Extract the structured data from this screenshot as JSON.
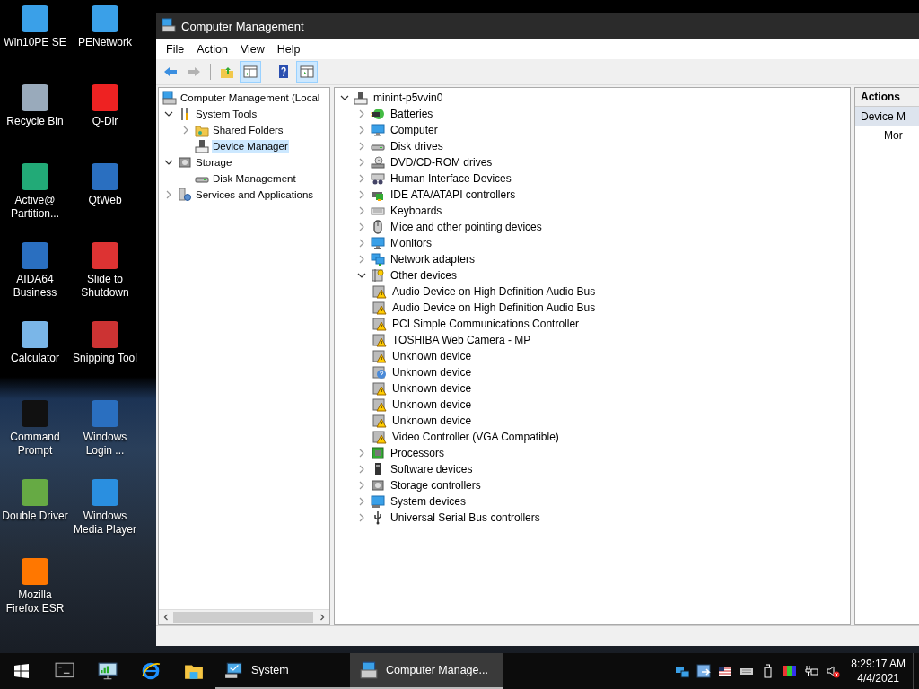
{
  "desktop_icons": [
    {
      "label": "Win10PE SE"
    },
    {
      "label": "PENetwork"
    },
    {
      "label": "Recycle Bin"
    },
    {
      "label": "Q-Dir"
    },
    {
      "label": "Active@ Partition..."
    },
    {
      "label": "QtWeb"
    },
    {
      "label": "AIDA64 Business"
    },
    {
      "label": "Slide to Shutdown"
    },
    {
      "label": "Calculator"
    },
    {
      "label": "Snipping Tool"
    },
    {
      "label": "Command Prompt"
    },
    {
      "label": "Windows Login ..."
    },
    {
      "label": "Double Driver"
    },
    {
      "label": "Windows Media Player"
    },
    {
      "label": "Mozilla Firefox ESR"
    }
  ],
  "window": {
    "title": "Computer Management"
  },
  "menu": [
    "File",
    "Action",
    "View",
    "Help"
  ],
  "toolbar": [
    {
      "pressed": false,
      "disabled": false
    },
    {
      "pressed": false,
      "disabled": true
    },
    {
      "pressed": false,
      "disabled": false
    },
    {
      "pressed": true,
      "disabled": false
    },
    {
      "pressed": false,
      "disabled": false
    },
    {
      "pressed": true,
      "disabled": false
    }
  ],
  "console_tree": {
    "label": "Computer Management (Local",
    "selected": false,
    "children": [
      {
        "label": "System Tools",
        "expanded": true,
        "selected": false,
        "children": [
          {
            "label": "Shared Folders",
            "expanded": false,
            "selected": false
          },
          {
            "label": "Device Manager",
            "selected": true
          }
        ]
      },
      {
        "label": "Storage",
        "expanded": true,
        "selected": false,
        "children": [
          {
            "label": "Disk Management",
            "selected": false
          }
        ]
      },
      {
        "label": "Services and Applications",
        "expanded": false,
        "selected": false
      }
    ]
  },
  "device_tree": {
    "label": "minint-p5vvin0",
    "expanded": true,
    "children": [
      {
        "label": "Batteries",
        "expanded": false
      },
      {
        "label": "Computer",
        "expanded": false
      },
      {
        "label": "Disk drives",
        "expanded": false
      },
      {
        "label": "DVD/CD-ROM drives",
        "expanded": false
      },
      {
        "label": "Human Interface Devices",
        "expanded": false
      },
      {
        "label": "IDE ATA/ATAPI controllers",
        "expanded": false
      },
      {
        "label": "Keyboards",
        "expanded": false
      },
      {
        "label": "Mice and other pointing devices",
        "expanded": false
      },
      {
        "label": "Monitors",
        "expanded": false
      },
      {
        "label": "Network adapters",
        "expanded": false
      },
      {
        "label": "Other devices",
        "expanded": true,
        "children": [
          {
            "label": "Audio Device on High Definition Audio Bus",
            "kind": "warning"
          },
          {
            "label": "Audio Device on High Definition Audio Bus",
            "kind": "warning"
          },
          {
            "label": "PCI Simple Communications Controller",
            "kind": "warning"
          },
          {
            "label": "TOSHIBA Web Camera - MP",
            "kind": "warning"
          },
          {
            "label": "Unknown device",
            "kind": "warning"
          },
          {
            "label": "Unknown device",
            "kind": "unknown"
          },
          {
            "label": "Unknown device",
            "kind": "warning"
          },
          {
            "label": "Unknown device",
            "kind": "warning"
          },
          {
            "label": "Unknown device",
            "kind": "warning"
          },
          {
            "label": "Video Controller (VGA Compatible)",
            "kind": "warning"
          }
        ]
      },
      {
        "label": "Processors",
        "expanded": false
      },
      {
        "label": "Software devices",
        "expanded": false
      },
      {
        "label": "Storage controllers",
        "expanded": false
      },
      {
        "label": "System devices",
        "expanded": false
      },
      {
        "label": "Universal Serial Bus controllers",
        "expanded": false
      }
    ]
  },
  "actions": {
    "title": "Actions",
    "items": [
      {
        "label": "Device M",
        "kind": "header"
      },
      {
        "label": "Mor",
        "kind": "item"
      }
    ]
  },
  "taskbar": {
    "tasks": [
      {
        "label": "System",
        "active": false
      },
      {
        "label": "Computer Manage...",
        "active": true
      }
    ],
    "clock": {
      "time": "8:29:17 AM",
      "date": "4/4/2021"
    }
  }
}
